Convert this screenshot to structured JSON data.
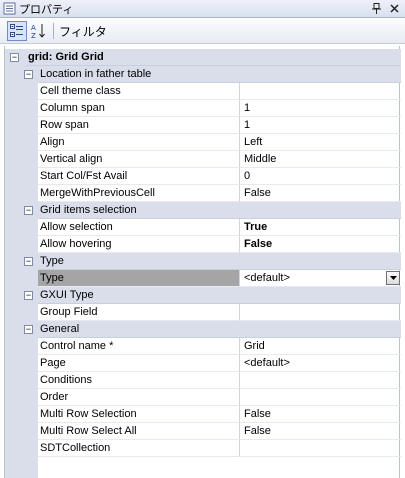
{
  "window": {
    "title": "プロパティ",
    "pin_glyph": "ꟸ",
    "close_glyph": "✕"
  },
  "toolbar": {
    "filter_label": "フィルタ"
  },
  "grid": {
    "title": "grid: Grid Grid",
    "categories": {
      "location": "Location in father table",
      "grid_items": "Grid items selection",
      "type": "Type",
      "gxui": "GXUI Type",
      "general": "General"
    },
    "rows": {
      "cell_theme_class": {
        "name": "Cell theme class",
        "value": ""
      },
      "column_span": {
        "name": "Column span",
        "value": "1"
      },
      "row_span": {
        "name": "Row span",
        "value": "1"
      },
      "align": {
        "name": "Align",
        "value": "Left"
      },
      "vertical_align": {
        "name": "Vertical align",
        "value": "Middle"
      },
      "start_col": {
        "name": "Start Col/Fst Avail",
        "value": "0"
      },
      "merge_prev": {
        "name": "MergeWithPreviousCell",
        "value": "False"
      },
      "allow_selection": {
        "name": "Allow selection",
        "value": "True"
      },
      "allow_hovering": {
        "name": "Allow hovering",
        "value": "False"
      },
      "type": {
        "name": "Type",
        "value": "<default>"
      },
      "group_field": {
        "name": "Group Field",
        "value": ""
      },
      "control_name": {
        "name": "Control name *",
        "value": "Grid"
      },
      "page": {
        "name": "Page",
        "value": "<default>"
      },
      "conditions": {
        "name": "Conditions",
        "value": ""
      },
      "order": {
        "name": "Order",
        "value": ""
      },
      "multi_row_selection": {
        "name": "Multi Row Selection",
        "value": "False"
      },
      "multi_row_select_all": {
        "name": "Multi Row Select All",
        "value": "False"
      },
      "sdt_collection": {
        "name": "SDTCollection",
        "value": ""
      }
    }
  },
  "expander_collapse_glyph": "−"
}
